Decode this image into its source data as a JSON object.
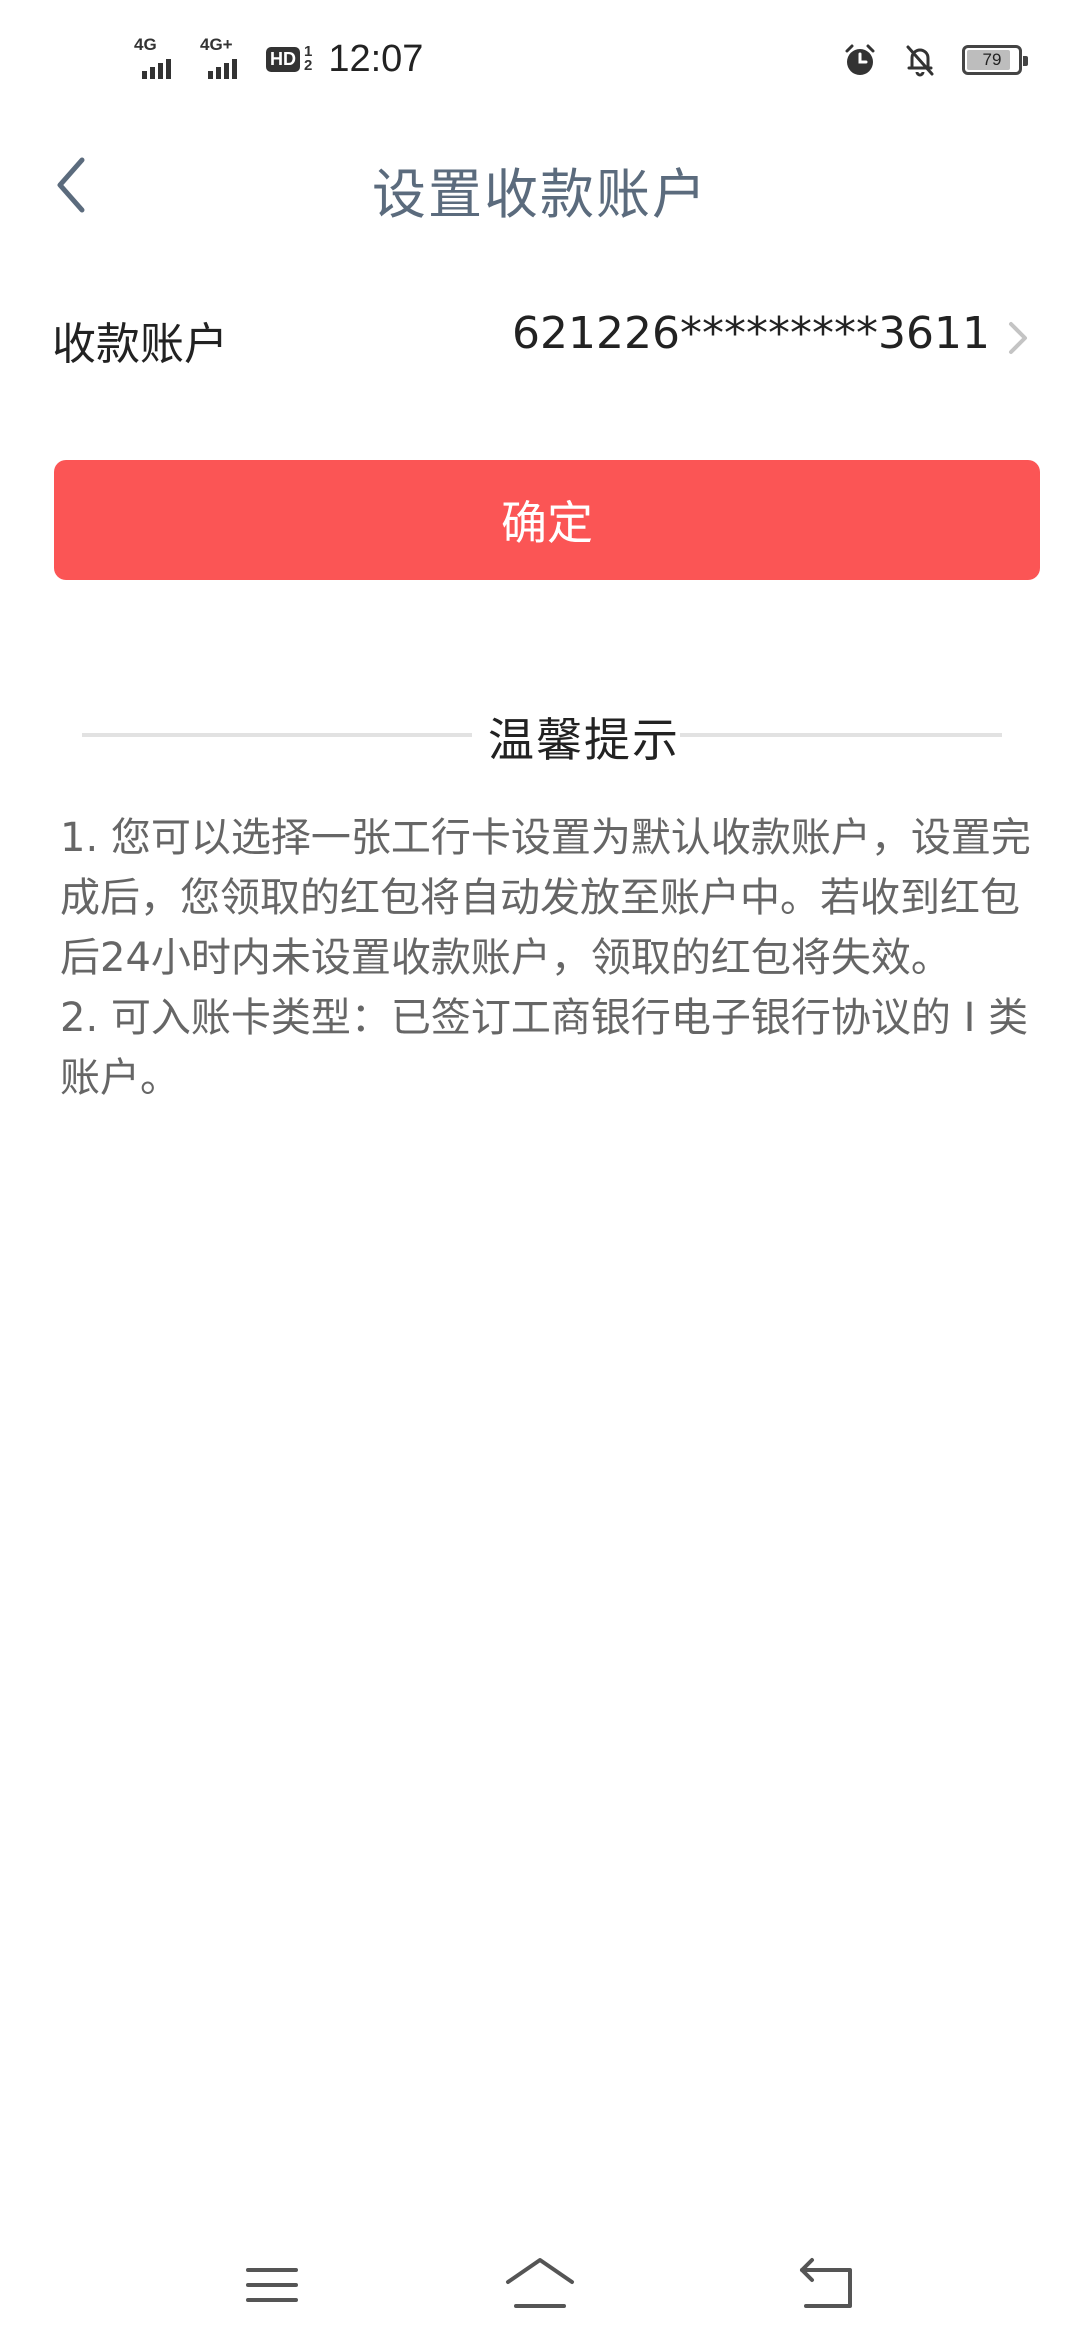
{
  "status_bar": {
    "sim1_type": "4G",
    "sim2_type": "4G+",
    "hd_label": "HD",
    "hd_fraction": "1\n2",
    "time": "12:07",
    "battery_level": "79",
    "icons": [
      "signal-icon",
      "signal-icon",
      "hd-voice-icon",
      "alarm-icon",
      "notifications-off-icon",
      "battery-icon"
    ]
  },
  "header": {
    "title": "设置收款账户",
    "back_icon": "chevron-left-icon"
  },
  "account": {
    "label": "收款账户",
    "value": "621226*********3611",
    "chevron_icon": "chevron-right-icon"
  },
  "confirm_button": {
    "label": "确定"
  },
  "tips": {
    "title": "温馨提示",
    "items": [
      "1. 您可以选择一张工行卡设置为默认收款账户，设置完成后，您领取的红包将自动发放至账户中。若收到红包后24小时内未设置收款账户，领取的红包将失效。",
      "2. 可入账卡类型：已签订工商银行电子银行协议的 I 类账户。"
    ]
  },
  "system_nav": {
    "icons": [
      "menu-icon",
      "home-icon",
      "back-icon"
    ]
  },
  "colors": {
    "accent": "#fb5555",
    "title": "#5b6b7d",
    "tip_text": "#666666",
    "divider": "#e2e2e2"
  }
}
